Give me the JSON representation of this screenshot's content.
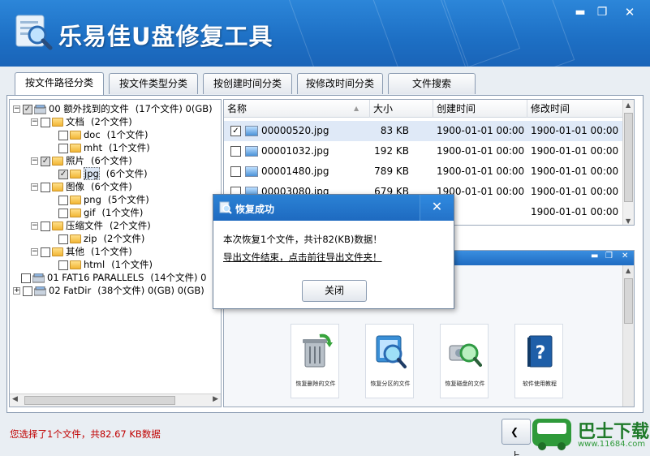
{
  "app": {
    "title": "乐易佳U盘修复工具"
  },
  "tabs": [
    "按文件路径分类",
    "按文件类型分类",
    "按创建时间分类",
    "按修改时间分类",
    "文件搜索"
  ],
  "tree": [
    {
      "name": "00  额外找到的文件",
      "count": "(17个文件) 0(GB)",
      "icon": "drive-icon"
    },
    {
      "name": "文档",
      "count": "(2个文件)",
      "icon": "folder-icon"
    },
    {
      "name": "doc",
      "count": "(1个文件)",
      "icon": "folder-icon"
    },
    {
      "name": "mht",
      "count": "(1个文件)",
      "icon": "folder-icon"
    },
    {
      "name": "照片",
      "count": "(6个文件)",
      "icon": "folder-icon"
    },
    {
      "name": "jpg",
      "count": "(6个文件)",
      "icon": "folder-icon"
    },
    {
      "name": "图像",
      "count": "(6个文件)",
      "icon": "folder-icon"
    },
    {
      "name": "png",
      "count": "(5个文件)",
      "icon": "folder-icon"
    },
    {
      "name": "gif",
      "count": "(1个文件)",
      "icon": "folder-icon"
    },
    {
      "name": "压缩文件",
      "count": "(2个文件)",
      "icon": "folder-icon"
    },
    {
      "name": "zip",
      "count": "(2个文件)",
      "icon": "folder-icon"
    },
    {
      "name": "其他",
      "count": "(1个文件)",
      "icon": "folder-icon"
    },
    {
      "name": "html",
      "count": "(1个文件)",
      "icon": "folder-icon"
    },
    {
      "name": "01  FAT16  PARALLELS",
      "count": "(14个文件) 0",
      "icon": "drive-icon"
    },
    {
      "name": "02  FatDir",
      "count": "(38个文件) 0(GB) 0(GB)",
      "icon": "drive-icon"
    }
  ],
  "filelist": {
    "columns": [
      "名称",
      "大小",
      "创建时间",
      "修改时间"
    ],
    "rows": [
      {
        "name": "00000520.jpg",
        "size": "83 KB",
        "created": "1900-01-01  00:00",
        "modified": "1900-01-01  00:00",
        "checked": "✓"
      },
      {
        "name": "00001032.jpg",
        "size": "192 KB",
        "created": "1900-01-01  00:00",
        "modified": "1900-01-01  00:00",
        "checked": ""
      },
      {
        "name": "00001480.jpg",
        "size": "789 KB",
        "created": "1900-01-01  00:00",
        "modified": "1900-01-01  00:00",
        "checked": ""
      },
      {
        "name": "00003080.jpg",
        "size": "679 KB",
        "created": "1900-01-01  00:00",
        "modified": "1900-01-01  00:00",
        "checked": ""
      },
      {
        "name": "",
        "size": "",
        "created": "",
        "modified": "1900-01-01  00:00",
        "checked": ""
      }
    ]
  },
  "preview": {
    "tiles": [
      "恢复删除的文件",
      "恢复分区的文件",
      "恢复磁盘的文件",
      "软件使用教程"
    ]
  },
  "status": "您选择了1个文件，共82.67 KB数据",
  "back_label": "上",
  "dialog": {
    "title": "恢复成功",
    "message": "本次恢复1个文件，共计82(KB)数据！",
    "link": "导出文件结束，点击前往导出文件夹！",
    "ok": "关闭",
    "close": "✕"
  },
  "watermark": {
    "text": "巴士下载",
    "url": "www.11684.com"
  },
  "colors": {
    "title_bar": "#1d6fc4",
    "status_text": "#c00000",
    "selection": "#dfe9f7"
  }
}
